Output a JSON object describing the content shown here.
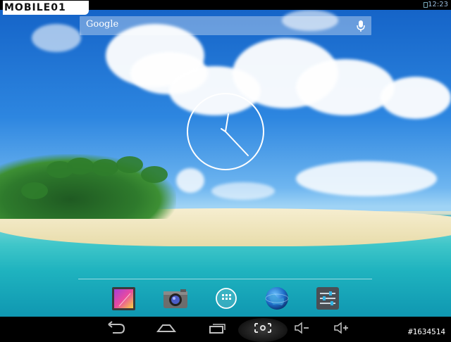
{
  "status_bar": {
    "brand": "MOBILE01",
    "time": "12:23"
  },
  "search": {
    "label": "Google"
  },
  "icons": {
    "mic": "microphone-icon",
    "gallery": "gallery-icon",
    "camera": "camera-icon",
    "apps": "app-drawer-icon",
    "browser": "browser-globe-icon",
    "settings": "settings-icon",
    "back": "back-icon",
    "home": "home-icon",
    "recents": "recent-apps-icon",
    "screenshot": "screenshot-icon",
    "volume_down": "volume-down-icon",
    "volume_up": "volume-up-icon"
  },
  "colors": {
    "accent_blue": "#33b5e5",
    "nav_gray": "#bfbfbf"
  },
  "watermark": "#1634514"
}
